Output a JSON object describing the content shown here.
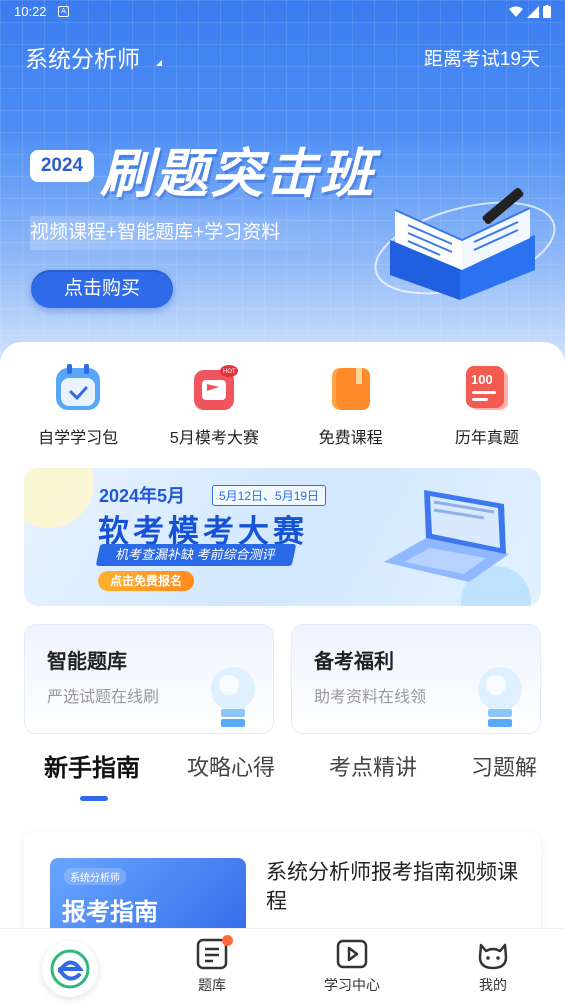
{
  "status_bar": {
    "time": "10:22",
    "notification": "A"
  },
  "header": {
    "title": "系统分析师",
    "countdown": "距离考试19天"
  },
  "hero": {
    "year": "2024",
    "headline": "刷题突击班",
    "subline": "视频课程+智能题库+学习资料",
    "buy_label": "点击购买"
  },
  "quick_entries": [
    {
      "label": "自学学习包",
      "icon": "calendar-icon"
    },
    {
      "label": "5月模考大赛",
      "icon": "flag-hot-icon"
    },
    {
      "label": "免费课程",
      "icon": "book-icon"
    },
    {
      "label": "历年真题",
      "icon": "score-100-icon"
    }
  ],
  "contest": {
    "year_month": "2024年5月",
    "dates": "5月12日、5月19日",
    "title": "软考模考大赛",
    "slogan": "机考查漏补缺    考前综合测评",
    "signup": "点击免费报名"
  },
  "cards": [
    {
      "title": "智能题库",
      "subtitle": "严选试题在线刷"
    },
    {
      "title": "备考福利",
      "subtitle": "助考资料在线领"
    }
  ],
  "tabs": [
    "新手指南",
    "攻略心得",
    "考点精讲",
    "习题解"
  ],
  "article": {
    "thumb_tag": "系统分析师",
    "thumb_title": "报考指南",
    "title": "系统分析师报考指南视频课程"
  },
  "bottom_nav": [
    {
      "label": "题库"
    },
    {
      "label": "学习中心"
    },
    {
      "label": "我的"
    }
  ],
  "colors": {
    "primary": "#2f6ae8",
    "badge": "#ff6a3d"
  }
}
